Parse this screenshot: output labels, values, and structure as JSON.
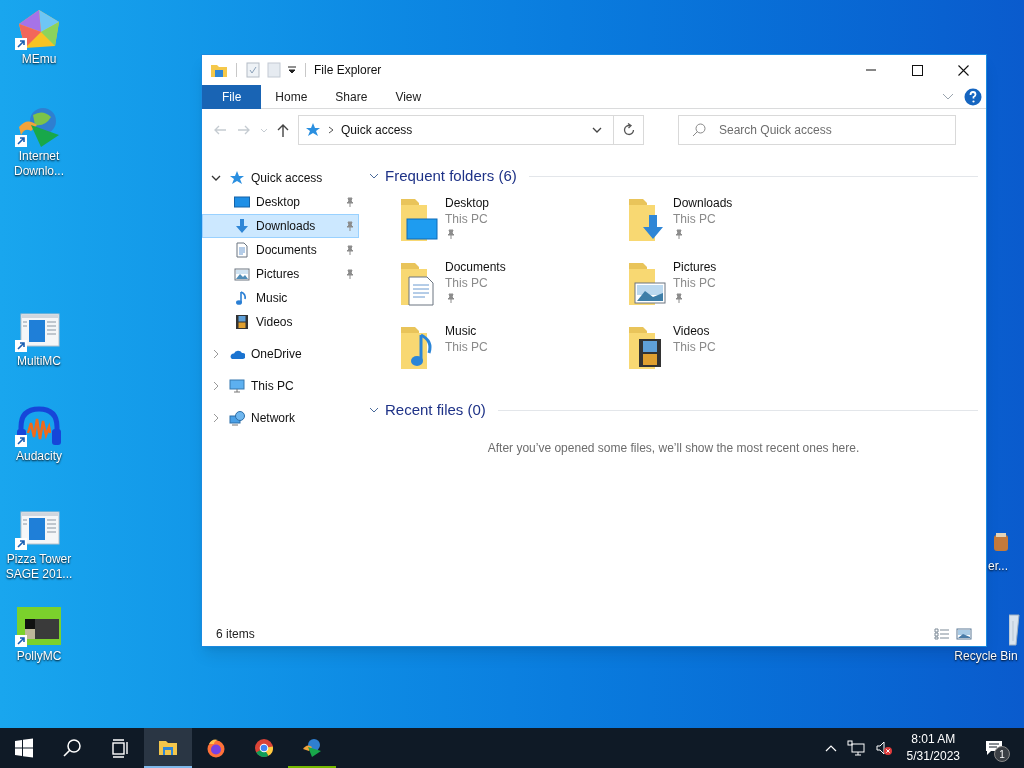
{
  "desktop_icons": [
    {
      "label": "MEmu",
      "kind": "memu"
    },
    {
      "label": "Internet Downlo...",
      "kind": "idm"
    },
    {
      "label": "MultiMC",
      "kind": "window"
    },
    {
      "label": "Audacity",
      "kind": "audacity"
    },
    {
      "label": "Pizza Tower SAGE 201...",
      "kind": "window"
    },
    {
      "label": "PollyMC",
      "kind": "polly"
    },
    {
      "label": "er...",
      "kind": "partial"
    },
    {
      "label": "Recycle Bin",
      "kind": "bin"
    }
  ],
  "window": {
    "title": "File Explorer",
    "ribbon_tabs": [
      {
        "label": "File",
        "selected": true
      },
      {
        "label": "Home",
        "selected": false
      },
      {
        "label": "Share",
        "selected": false
      },
      {
        "label": "View",
        "selected": false
      }
    ],
    "address": "Quick access",
    "search": {
      "placeholder": "Search Quick access"
    },
    "nav_tree": [
      {
        "label": "Quick access",
        "kind": "star",
        "expanded": true,
        "selected": false,
        "children": [
          {
            "label": "Desktop",
            "kind": "desktop",
            "pinned": true,
            "selected": false
          },
          {
            "label": "Downloads",
            "kind": "downloads",
            "pinned": true,
            "selected": true
          },
          {
            "label": "Documents",
            "kind": "documents",
            "pinned": true,
            "selected": false
          },
          {
            "label": "Pictures",
            "kind": "pictures",
            "pinned": true,
            "selected": false
          },
          {
            "label": "Music",
            "kind": "music",
            "pinned": false,
            "selected": false
          },
          {
            "label": "Videos",
            "kind": "videos",
            "pinned": false,
            "selected": false
          }
        ]
      },
      {
        "label": "OneDrive",
        "kind": "cloud",
        "expanded": false,
        "selected": false
      },
      {
        "label": "This PC",
        "kind": "pc",
        "expanded": false,
        "selected": false
      },
      {
        "label": "Network",
        "kind": "network",
        "expanded": false,
        "selected": false
      }
    ],
    "sections": [
      {
        "title": "Frequent folders (6)",
        "expanded": true,
        "folders": [
          {
            "name": "Desktop",
            "location": "This PC",
            "kind": "desktop",
            "pinned": true
          },
          {
            "name": "Downloads",
            "location": "This PC",
            "kind": "downloads",
            "pinned": true
          },
          {
            "name": "Documents",
            "location": "This PC",
            "kind": "documents",
            "pinned": true
          },
          {
            "name": "Pictures",
            "location": "This PC",
            "kind": "pictures",
            "pinned": true
          },
          {
            "name": "Music",
            "location": "This PC",
            "kind": "music",
            "pinned": false
          },
          {
            "name": "Videos",
            "location": "This PC",
            "kind": "videos",
            "pinned": false
          }
        ]
      },
      {
        "title": "Recent files (0)",
        "expanded": true,
        "message": "After you’ve opened some files, we’ll show the most recent ones here."
      }
    ],
    "status_bar": "6 items"
  },
  "taskbar": {
    "apps": [
      {
        "kind": "explorer",
        "selected": true,
        "running": true
      },
      {
        "kind": "firefox",
        "selected": false,
        "running": false
      },
      {
        "kind": "chrome",
        "selected": false,
        "running": false
      },
      {
        "kind": "idm",
        "selected": false,
        "running": true
      }
    ],
    "time": "8:01 AM",
    "date": "5/31/2023",
    "notifications": "1"
  }
}
